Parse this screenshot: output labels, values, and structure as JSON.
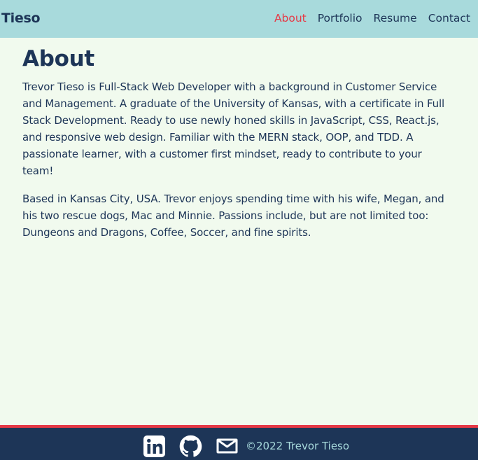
{
  "brand": "Tieso",
  "nav": {
    "items": [
      {
        "label": "About",
        "active": true
      },
      {
        "label": "Portfolio",
        "active": false
      },
      {
        "label": "Resume",
        "active": false
      },
      {
        "label": "Contact",
        "active": false
      }
    ]
  },
  "main": {
    "title": "About",
    "paragraphs": [
      "Trevor Tieso is Full-Stack Web Developer with a background in Customer Service and Management. A graduate of the University of Kansas, with a certificate in Full Stack Development. Ready to use newly honed skills in JavaScript, CSS, React.js, and responsive web design. Familiar with the MERN stack, OOP, and TDD. A passionate learner, with a customer first mindset, ready to contribute to your team!",
      "Based in Kansas City, USA. Trevor enjoys spending time with his wife, Megan, and his two rescue dogs, Mac and Minnie. Passions include, but are not limited too: Dungeons and Dragons, Coffee, Soccer, and fine spirits."
    ]
  },
  "footer": {
    "icons": [
      "linkedin-icon",
      "github-icon",
      "email-icon"
    ],
    "copyright": "©2022 Trevor Tieso"
  },
  "colors": {
    "navbar_bg": "#a8dadc",
    "page_bg": "#f1faee",
    "text": "#1d3557",
    "accent": "#e63946",
    "footer_bg": "#1d3557",
    "footer_text": "#a8dadc"
  }
}
